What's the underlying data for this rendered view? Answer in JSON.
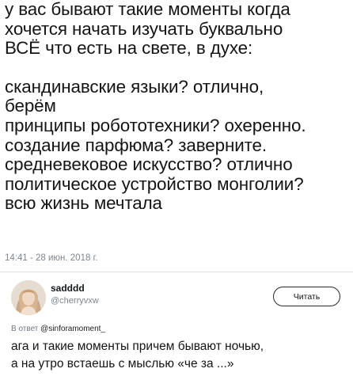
{
  "tweet": {
    "lines": [
      "у вас бывают такие моменты когда",
      "хочется начать изучать буквально",
      "ВСЁ что есть на свете, в духе:",
      "скандинавские языки? отлично,",
      "берём",
      "принципы робототехники? охеренно.",
      "создание парфюма? заверните.",
      "средневековое искусство? отлично",
      "политическое устройство монголии?",
      "всю жизнь мечтала"
    ],
    "timestamp": "14:41 - 28 июн. 2018 г."
  },
  "reply": {
    "name": "sadddd",
    "handle": "@cherryvxw",
    "follow_label": "Читать",
    "in_reply_prefix": "В ответ",
    "in_reply_mention": "@sinforamoment_",
    "lines": [
      "ага и такие моменты причем бывают ночью,",
      "а на утро встаешь с мыслью «че за ...»"
    ]
  }
}
